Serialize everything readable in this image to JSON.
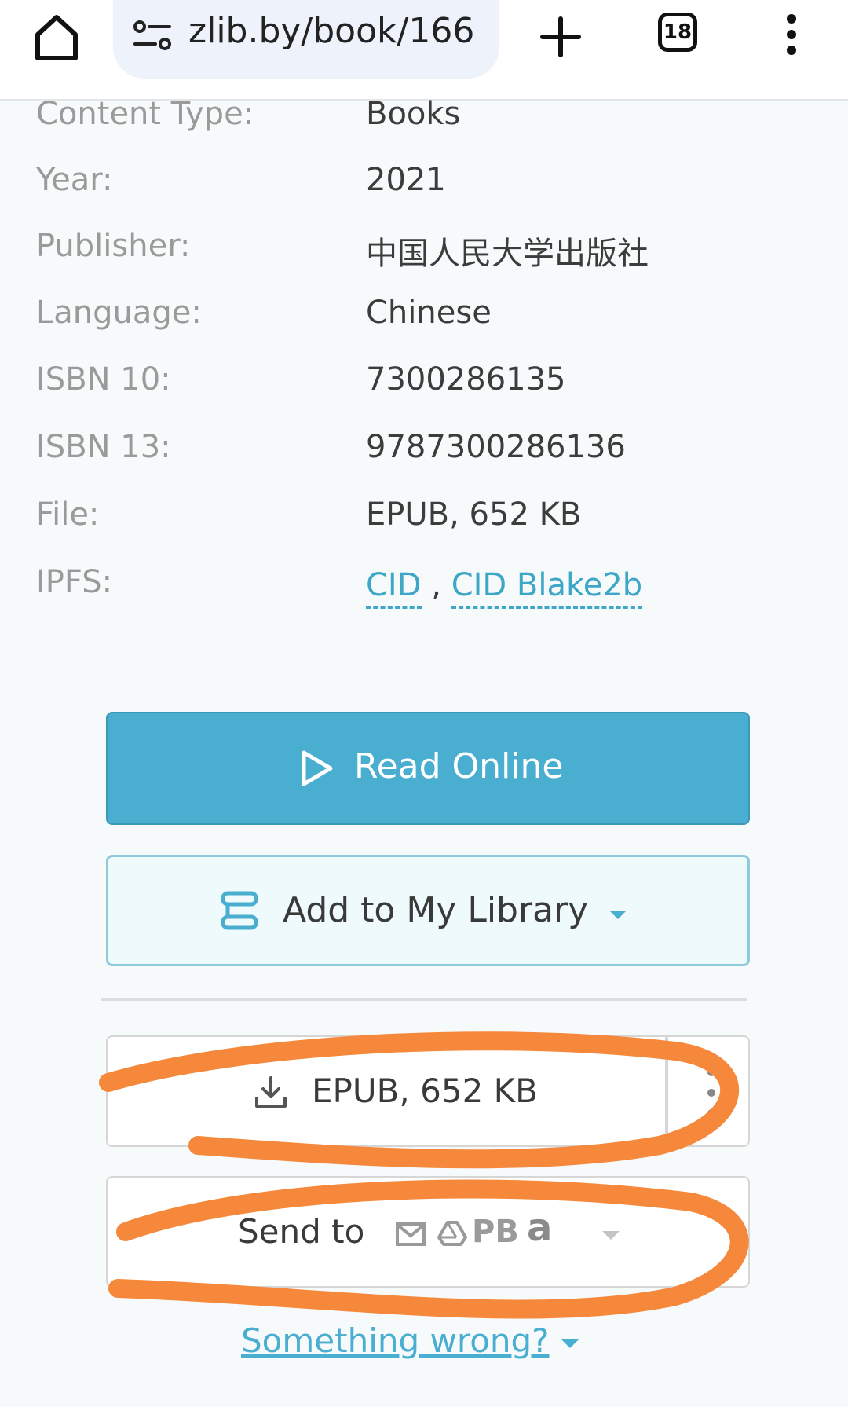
{
  "browser": {
    "url": "zlib.by/book/166",
    "tab_count": "18"
  },
  "details": [
    {
      "label": "Content Type:",
      "value": "Books"
    },
    {
      "label": "Year:",
      "value": "2021"
    },
    {
      "label": "Publisher:",
      "value": "中国人民大学出版社"
    },
    {
      "label": "Language:",
      "value": "Chinese"
    },
    {
      "label": "ISBN 10:",
      "value": "7300286135"
    },
    {
      "label": "ISBN 13:",
      "value": "9787300286136"
    },
    {
      "label": "File:",
      "value": "EPUB, 652 KB"
    }
  ],
  "ipfs": {
    "label": "IPFS:",
    "cid": "CID",
    "separator": ",",
    "cid_blake": "CID Blake2b"
  },
  "actions": {
    "read_online": "Read Online",
    "add_library": "Add to My Library",
    "download": "EPUB, 652 KB",
    "send_to": "Send to",
    "send_pb": "PB",
    "send_amazon": "a",
    "something_wrong": "Something wrong?"
  },
  "colors": {
    "accent": "#4aaed1",
    "annotation": "#f5883a"
  }
}
